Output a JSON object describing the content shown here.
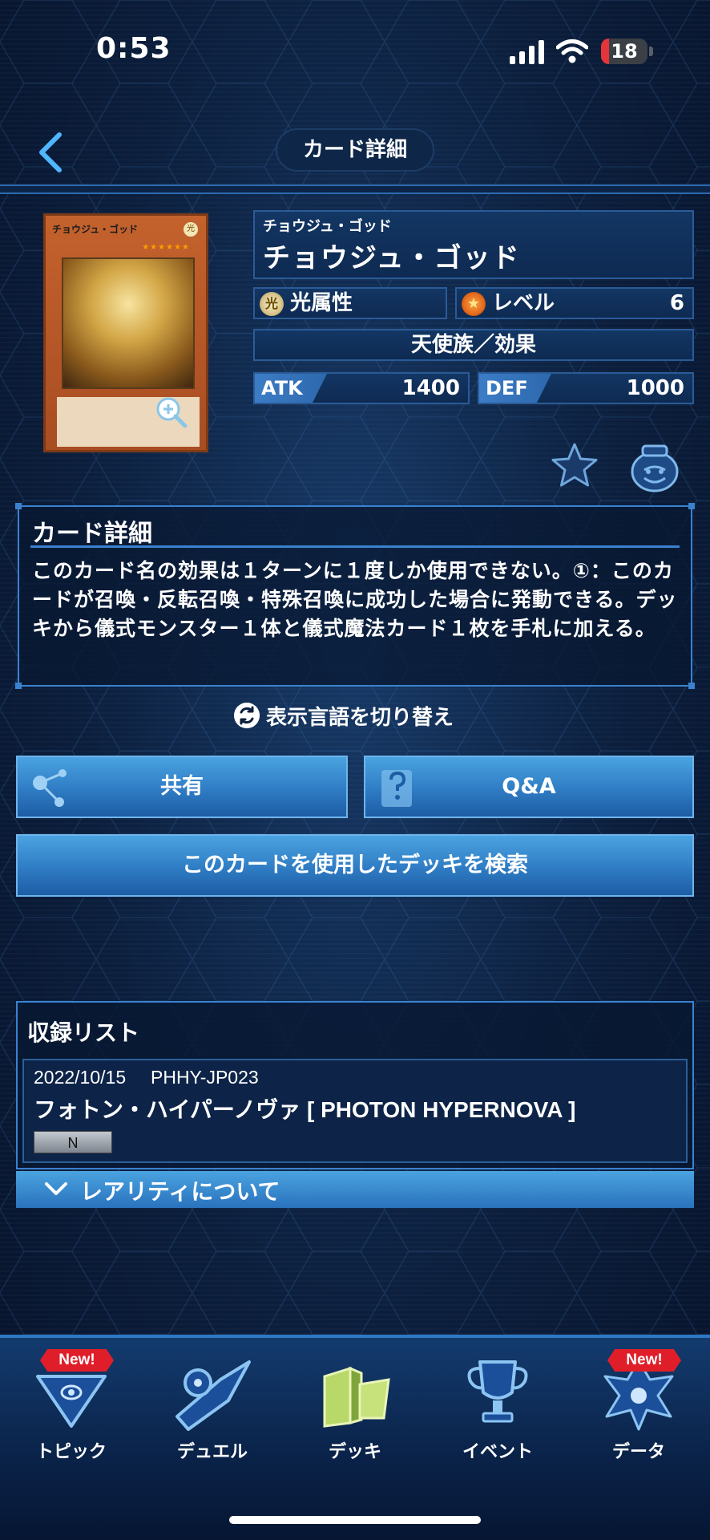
{
  "status_bar": {
    "time": "0:53",
    "battery": "18",
    "battery_level": 0.18
  },
  "header": {
    "title": "カード詳細"
  },
  "card": {
    "image_name": "チョウジュ・ゴッド",
    "image_attr": "光",
    "image_stars": "★★★★★★",
    "ruby": "チョウジュ・ゴッド",
    "name": "チョウジュ・ゴッド",
    "attribute_icon": "光",
    "attribute": "光属性",
    "level_label": "レベル",
    "level": "6",
    "type": "天使族／効果",
    "atk_label": "ATK",
    "atk": "1400",
    "def_label": "DEF",
    "def": "1000"
  },
  "description": {
    "heading": "カード詳細",
    "text": "このカード名の効果は１ターンに１度しか使用できない。①：このカードが召喚・反転召喚・特殊召喚に成功した場合に発動できる。デッキから儀式モンスター１体と儀式魔法カード１枚を手札に加える。"
  },
  "language_toggle": "表示言語を切り替え",
  "buttons": {
    "share": "共有",
    "qa": "Q&A",
    "search_decks": "このカードを使用したデッキを検索"
  },
  "recording_list": {
    "title": "収録リスト",
    "items": [
      {
        "date": "2022/10/15",
        "code": "PHHY-JP023",
        "set": "フォトン・ハイパーノヴァ [ PHOTON HYPERNOVA ]",
        "rarity": "N"
      }
    ],
    "rarity_toggle": "レアリティについて"
  },
  "bottom_nav": {
    "items": [
      {
        "label": "トピック",
        "badge": "New!",
        "icon": "topic-icon"
      },
      {
        "label": "デュエル",
        "badge": "",
        "icon": "duel-disk-icon"
      },
      {
        "label": "デッキ",
        "badge": "",
        "icon": "deck-icon"
      },
      {
        "label": "イベント",
        "badge": "",
        "icon": "trophy-icon"
      },
      {
        "label": "データ",
        "badge": "New!",
        "icon": "data-icon"
      }
    ]
  },
  "colors": {
    "accent": "#3a82d0",
    "button": "#2f7cc4",
    "badge": "#e01e2a"
  }
}
